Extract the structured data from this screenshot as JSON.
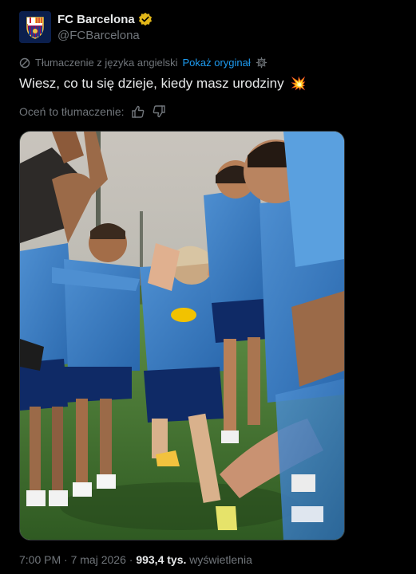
{
  "account": {
    "display_name": "FC Barcelona",
    "handle": "@FCBarcelona"
  },
  "translation": {
    "label": "Tłumaczenie z języka angielski",
    "show_original": "Pokaż oryginał"
  },
  "tweet": {
    "text": "Wiesz, co tu się dzieje, kiedy masz urodziny",
    "emoji": "💥"
  },
  "rate": {
    "label": "Oceń to tłumaczenie:"
  },
  "meta": {
    "time": "7:00 PM",
    "date": "7 maj 2026",
    "views_count": "993,4 tys.",
    "views_label": "wyświetlenia",
    "separator": "·"
  },
  "colors": {
    "background": "#000000",
    "link": "#1d9bf0",
    "muted": "#71767b",
    "verified": "#e2b719"
  }
}
